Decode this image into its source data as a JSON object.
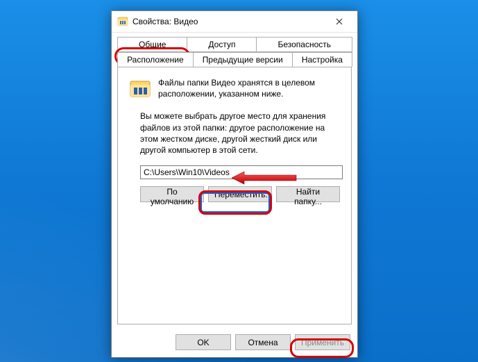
{
  "window": {
    "title": "Свойства: Видео"
  },
  "tabs": {
    "row1": [
      "Общие",
      "Доступ",
      "Безопасность"
    ],
    "row2": [
      "Расположение",
      "Предыдущие версии",
      "Настройка"
    ],
    "active": "Расположение"
  },
  "content": {
    "info_text": "Файлы папки Видео хранятся в целевом расположении, указанном ниже.",
    "hint_text": "Вы можете выбрать другое место для хранения файлов из этой папки: другое расположение на этом жестком диске, другой жесткий диск или другой компьютер в этой сети.",
    "path_value": "C:\\Users\\Win10\\Videos",
    "btn_default": "По умолчанию",
    "btn_move": "Переместить...",
    "btn_find": "Найти папку..."
  },
  "footer": {
    "ok": "OK",
    "cancel": "Отмена",
    "apply": "Применить"
  }
}
